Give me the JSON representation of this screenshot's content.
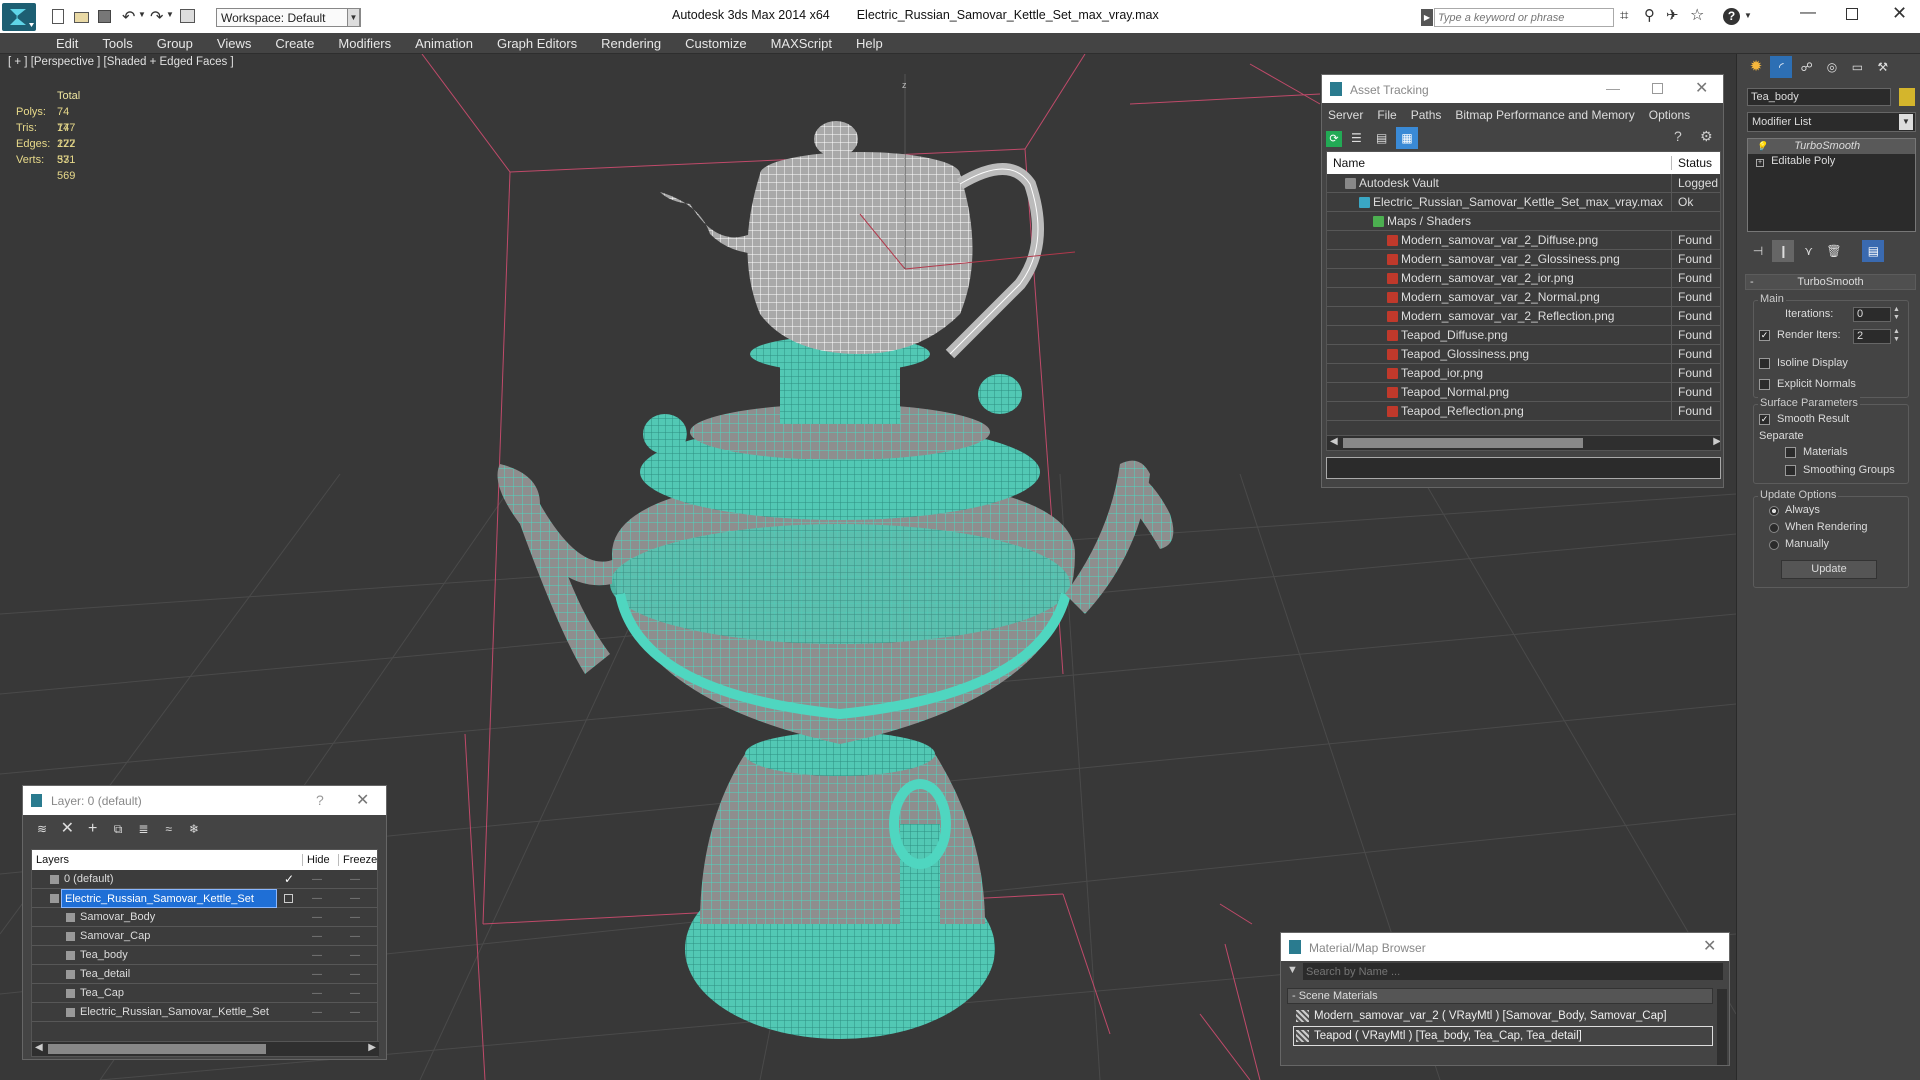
{
  "app": {
    "title": "Autodesk 3ds Max  2014 x64",
    "file": "Electric_Russian_Samovar_Kettle_Set_max_vray.max",
    "workspace": "Workspace: Default",
    "search_placeholder": "Type a keyword or phrase"
  },
  "menu": [
    "Edit",
    "Tools",
    "Group",
    "Views",
    "Create",
    "Modifiers",
    "Animation",
    "Graph Editors",
    "Rendering",
    "Customize",
    "MAXScript",
    "Help"
  ],
  "viewport": {
    "label": "[ + ] [Perspective ] [Shaded + Edged Faces ]",
    "stats": {
      "header": "Total",
      "rows": [
        {
          "k": "Polys:",
          "v": "74 177"
        },
        {
          "k": "Tris:",
          "v": "74 177"
        },
        {
          "k": "Edges:",
          "v": "222 531"
        },
        {
          "k": "Verts:",
          "v": "37 569"
        }
      ]
    }
  },
  "asset_tracking": {
    "title": "Asset Tracking",
    "menu": [
      "Server",
      "File",
      "Paths",
      "Bitmap Performance and Memory",
      "Options"
    ],
    "col_name": "Name",
    "col_status": "Status",
    "rows": [
      {
        "name": "Autodesk Vault",
        "status": "Logged O",
        "indent": 1,
        "icon": "vault"
      },
      {
        "name": "Electric_Russian_Samovar_Kettle_Set_max_vray.max",
        "status": "Ok",
        "indent": 2,
        "icon": "max"
      },
      {
        "name": "Maps / Shaders",
        "status": "",
        "indent": 3,
        "icon": "maps"
      },
      {
        "name": "Modern_samovar_var_2_Diffuse.png",
        "status": "Found",
        "indent": 4,
        "icon": "png"
      },
      {
        "name": "Modern_samovar_var_2_Glossiness.png",
        "status": "Found",
        "indent": 4,
        "icon": "png"
      },
      {
        "name": "Modern_samovar_var_2_ior.png",
        "status": "Found",
        "indent": 4,
        "icon": "png"
      },
      {
        "name": "Modern_samovar_var_2_Normal.png",
        "status": "Found",
        "indent": 4,
        "icon": "png"
      },
      {
        "name": "Modern_samovar_var_2_Reflection.png",
        "status": "Found",
        "indent": 4,
        "icon": "png"
      },
      {
        "name": "Teapod_Diffuse.png",
        "status": "Found",
        "indent": 4,
        "icon": "png"
      },
      {
        "name": "Teapod_Glossiness.png",
        "status": "Found",
        "indent": 4,
        "icon": "png"
      },
      {
        "name": "Teapod_ior.png",
        "status": "Found",
        "indent": 4,
        "icon": "png"
      },
      {
        "name": "Teapod_Normal.png",
        "status": "Found",
        "indent": 4,
        "icon": "png"
      },
      {
        "name": "Teapod_Reflection.png",
        "status": "Found",
        "indent": 4,
        "icon": "png"
      }
    ]
  },
  "layers": {
    "title": "Layer: 0 (default)",
    "col_layers": "Layers",
    "col_hide": "Hide",
    "col_freeze": "Freeze",
    "rows": [
      {
        "name": "0 (default)",
        "indent": 0,
        "selected": false,
        "active": true
      },
      {
        "name": "Electric_Russian_Samovar_Kettle_Set",
        "indent": 0,
        "selected": true,
        "active": false
      },
      {
        "name": "Samovar_Body",
        "indent": 1,
        "selected": false,
        "active": false
      },
      {
        "name": "Samovar_Cap",
        "indent": 1,
        "selected": false,
        "active": false
      },
      {
        "name": "Tea_body",
        "indent": 1,
        "selected": false,
        "active": false
      },
      {
        "name": "Tea_detail",
        "indent": 1,
        "selected": false,
        "active": false
      },
      {
        "name": "Tea_Cap",
        "indent": 1,
        "selected": false,
        "active": false
      },
      {
        "name": "Electric_Russian_Samovar_Kettle_Set",
        "indent": 1,
        "selected": false,
        "active": false
      }
    ]
  },
  "material_browser": {
    "title": "Material/Map Browser",
    "search_placeholder": "Search by Name ...",
    "section": "- Scene Materials",
    "items": [
      "Modern_samovar_var_2  ( VRayMtl ) [Samovar_Body, Samovar_Cap]",
      "Teapod  ( VRayMtl ) [Tea_body, Tea_Cap, Tea_detail]"
    ]
  },
  "command_panel": {
    "object_name": "Tea_body",
    "modifier_list": "Modifier List",
    "stack": [
      "TurboSmooth",
      "Editable Poly"
    ],
    "rollout_title": "TurboSmooth",
    "main_label": "Main",
    "iterations_label": "Iterations:",
    "iterations": "0",
    "render_iters_label": "Render Iters:",
    "render_iters": "2",
    "isoline": "Isoline Display",
    "explicit": "Explicit Normals",
    "surface_label": "Surface Parameters",
    "smooth_result": "Smooth Result",
    "separate": "Separate",
    "materials": "Materials",
    "smoothing_groups": "Smoothing Groups",
    "update_label": "Update Options",
    "always": "Always",
    "when_rendering": "When Rendering",
    "manually": "Manually",
    "update_btn": "Update"
  },
  "colors": {
    "mesh_teal": "#4fd6c0",
    "wire": "#ffffff",
    "viewport_bg": "#383838",
    "selection": "#1f6fd6"
  }
}
